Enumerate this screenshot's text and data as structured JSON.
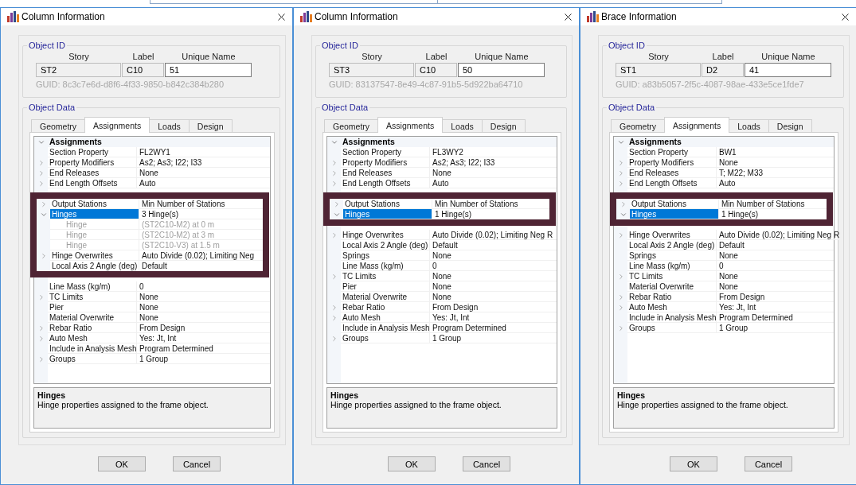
{
  "dialogs": [
    {
      "title": "Column Information",
      "object_id": {
        "heading": "Object ID",
        "columns": [
          "Story",
          "Label",
          "Unique Name"
        ],
        "story": "ST2",
        "label": "C10",
        "unique_name": "51",
        "guid": "GUID: 8c3c7e6d-d8f6-4f33-9850-b842c384b280"
      },
      "object_data": {
        "heading": "Object Data",
        "tabs": [
          {
            "label": "Geometry",
            "selected": false
          },
          {
            "label": "Assignments",
            "selected": true
          },
          {
            "label": "Loads",
            "selected": false
          },
          {
            "label": "Design",
            "selected": false
          }
        ],
        "grid": {
          "category": "Assignments",
          "expanded": true,
          "rows": [
            {
              "kind": "property",
              "label": "Section Property",
              "value": "FL2WY1",
              "selected": false
            },
            {
              "kind": "property",
              "label": "Property Modifiers",
              "value": "As2; As3; I22; I33",
              "expanded": false,
              "selected": false
            },
            {
              "kind": "property",
              "label": "End Releases",
              "value": "None",
              "expanded": false,
              "selected": false
            },
            {
              "kind": "property",
              "label": "End Length Offsets",
              "value": "Auto",
              "expanded": false,
              "selected": false
            },
            {
              "kind": "highlight_frame",
              "rows": [
                {
                  "kind": "property",
                  "label": "Output Stations",
                  "value": "Min Number of Stations",
                  "expanded": false,
                  "selected": false
                },
                {
                  "kind": "property",
                  "label": "Hinges",
                  "value": "3 Hinge(s)",
                  "expanded": true,
                  "selected": true,
                  "children": [
                    {
                      "label": "Hinge",
                      "value": "(ST2C10-M2) at 0 m",
                      "selected": false
                    },
                    {
                      "label": "Hinge",
                      "value": "(ST2C10-M2) at 3 m",
                      "selected": false
                    },
                    {
                      "label": "Hinge",
                      "value": "(ST2C10-V3) at 1.5 m",
                      "selected": false
                    }
                  ]
                },
                {
                  "kind": "property",
                  "label": "Hinge Overwrites",
                  "value": "Auto Divide (0.02); Limiting Neg",
                  "expanded": false,
                  "selected": false
                },
                {
                  "kind": "property",
                  "label": "Local Axis 2 Angle (deg)",
                  "value": "Default",
                  "selected": false
                }
              ]
            },
            {
              "kind": "property",
              "label": "Line Mass (kg/m)",
              "value": "0",
              "selected": false
            },
            {
              "kind": "property",
              "label": "TC Limits",
              "value": "None",
              "expanded": false,
              "selected": false
            },
            {
              "kind": "property",
              "label": "Pier",
              "value": "None",
              "selected": false
            },
            {
              "kind": "property",
              "label": "Material Overwrite",
              "value": "None",
              "selected": false
            },
            {
              "kind": "property",
              "label": "Rebar Ratio",
              "value": "From Design",
              "expanded": false,
              "selected": false
            },
            {
              "kind": "property",
              "label": "Auto Mesh",
              "value": "Yes: Jt, Int",
              "expanded": false,
              "selected": false
            },
            {
              "kind": "property",
              "label": "Include in Analysis Mesh",
              "value": "Program Determined",
              "selected": false
            },
            {
              "kind": "property",
              "label": "Groups",
              "value": "1 Group",
              "expanded": false,
              "selected": false
            }
          ]
        },
        "description": {
          "title": "Hinges",
          "text": "Hinge properties assigned to the frame object."
        }
      },
      "buttons": [
        "OK",
        "Cancel"
      ]
    },
    {
      "title": "Column Information",
      "object_id": {
        "heading": "Object ID",
        "columns": [
          "Story",
          "Label",
          "Unique Name"
        ],
        "story": "ST3",
        "label": "C10",
        "unique_name": "50",
        "guid": "GUID: 83137547-8e49-4c87-91b5-5d922ba64710"
      },
      "object_data": {
        "heading": "Object Data",
        "tabs": [
          {
            "label": "Geometry",
            "selected": false
          },
          {
            "label": "Assignments",
            "selected": true
          },
          {
            "label": "Loads",
            "selected": false
          },
          {
            "label": "Design",
            "selected": false
          }
        ],
        "grid": {
          "category": "Assignments",
          "expanded": true,
          "rows": [
            {
              "kind": "property",
              "label": "Section Property",
              "value": "FL3WY2",
              "selected": false
            },
            {
              "kind": "property",
              "label": "Property Modifiers",
              "value": "As2; As3; I22; I33",
              "expanded": false,
              "selected": false
            },
            {
              "kind": "property",
              "label": "End Releases",
              "value": "None",
              "expanded": false,
              "selected": false
            },
            {
              "kind": "property",
              "label": "End Length Offsets",
              "value": "Auto",
              "expanded": false,
              "selected": false
            },
            {
              "kind": "highlight_frame",
              "rows": [
                {
                  "kind": "property",
                  "label": "Output Stations",
                  "value": "Min Number of Stations",
                  "expanded": false,
                  "selected": false
                },
                {
                  "kind": "property",
                  "label": "Hinges",
                  "value": "1 Hinge(s)",
                  "expanded": true,
                  "selected": true
                }
              ]
            },
            {
              "kind": "property",
              "label": "Hinge Overwrites",
              "value": "Auto Divide (0.02); Limiting Neg R",
              "expanded": false,
              "selected": false
            },
            {
              "kind": "property",
              "label": "Local Axis 2 Angle (deg)",
              "value": "Default",
              "selected": false
            },
            {
              "kind": "property",
              "label": "Springs",
              "value": "None",
              "selected": false
            },
            {
              "kind": "property",
              "label": "Line Mass (kg/m)",
              "value": "0",
              "selected": false
            },
            {
              "kind": "property",
              "label": "TC Limits",
              "value": "None",
              "expanded": false,
              "selected": false
            },
            {
              "kind": "property",
              "label": "Pier",
              "value": "None",
              "selected": false
            },
            {
              "kind": "property",
              "label": "Material Overwrite",
              "value": "None",
              "selected": false
            },
            {
              "kind": "property",
              "label": "Rebar Ratio",
              "value": "From Design",
              "expanded": false,
              "selected": false
            },
            {
              "kind": "property",
              "label": "Auto Mesh",
              "value": "Yes: Jt, Int",
              "expanded": false,
              "selected": false
            },
            {
              "kind": "property",
              "label": "Include in Analysis Mesh",
              "value": "Program Determined",
              "selected": false
            },
            {
              "kind": "property",
              "label": "Groups",
              "value": "1 Group",
              "expanded": false,
              "selected": false
            }
          ]
        },
        "description": {
          "title": "Hinges",
          "text": "Hinge properties assigned to the frame object."
        }
      },
      "buttons": [
        "OK",
        "Cancel"
      ]
    },
    {
      "title": "Brace Information",
      "object_id": {
        "heading": "Object ID",
        "columns": [
          "Story",
          "Label",
          "Unique Name"
        ],
        "story": "ST1",
        "label": "D2",
        "unique_name": "41",
        "guid": "GUID: a83b5057-2f5c-4087-98ae-433e5ce1fde7"
      },
      "object_data": {
        "heading": "Object Data",
        "tabs": [
          {
            "label": "Geometry",
            "selected": false
          },
          {
            "label": "Assignments",
            "selected": true
          },
          {
            "label": "Loads",
            "selected": false
          },
          {
            "label": "Design",
            "selected": false
          }
        ],
        "grid": {
          "category": "Assignments",
          "expanded": true,
          "rows": [
            {
              "kind": "property",
              "label": "Section Property",
              "value": "BW1",
              "selected": false
            },
            {
              "kind": "property",
              "label": "Property Modifiers",
              "value": "None",
              "expanded": false,
              "selected": false
            },
            {
              "kind": "property",
              "label": "End Releases",
              "value": "T; M22; M33",
              "expanded": false,
              "selected": false
            },
            {
              "kind": "property",
              "label": "End Length Offsets",
              "value": "Auto",
              "expanded": false,
              "selected": false
            },
            {
              "kind": "highlight_frame",
              "rows": [
                {
                  "kind": "property",
                  "label": "Output Stations",
                  "value": "Min Number of Stations",
                  "expanded": false,
                  "selected": false
                },
                {
                  "kind": "property",
                  "label": "Hinges",
                  "value": "1 Hinge(s)",
                  "expanded": true,
                  "selected": true
                }
              ]
            },
            {
              "kind": "property",
              "label": "Hinge Overwrites",
              "value": "Auto Divide (0.02); Limiting Neg R",
              "expanded": false,
              "selected": false
            },
            {
              "kind": "property",
              "label": "Local Axis 2 Angle (deg)",
              "value": "Default",
              "selected": false
            },
            {
              "kind": "property",
              "label": "Springs",
              "value": "None",
              "selected": false
            },
            {
              "kind": "property",
              "label": "Line Mass (kg/m)",
              "value": "0",
              "selected": false
            },
            {
              "kind": "property",
              "label": "TC Limits",
              "value": "None",
              "expanded": false,
              "selected": false
            },
            {
              "kind": "property",
              "label": "Material Overwrite",
              "value": "None",
              "selected": false
            },
            {
              "kind": "property",
              "label": "Rebar Ratio",
              "value": "From Design",
              "expanded": false,
              "selected": false
            },
            {
              "kind": "property",
              "label": "Auto Mesh",
              "value": "Yes: Jt, Int",
              "expanded": false,
              "selected": false
            },
            {
              "kind": "property",
              "label": "Include in Analysis Mesh",
              "value": "Program Determined",
              "selected": false
            },
            {
              "kind": "property",
              "label": "Groups",
              "value": "1 Group",
              "expanded": false,
              "selected": false
            }
          ]
        },
        "description": {
          "title": "Hinges",
          "text": "Hinge properties assigned to the frame object."
        }
      },
      "buttons": [
        "OK",
        "Cancel"
      ]
    }
  ]
}
